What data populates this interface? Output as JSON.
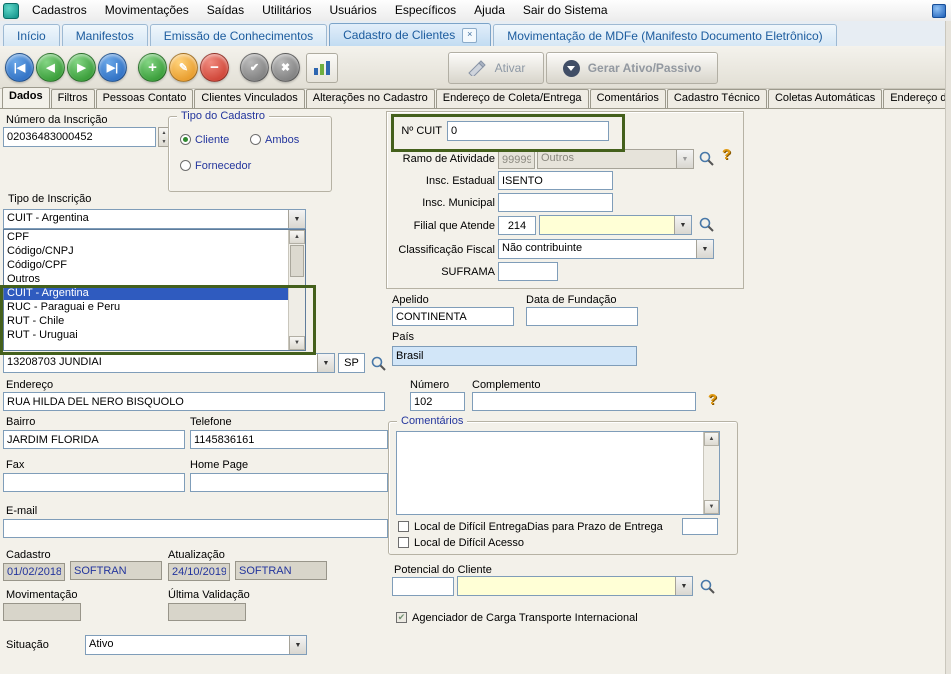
{
  "menu": {
    "items": [
      "Cadastros",
      "Movimentações",
      "Saídas",
      "Utilitários",
      "Usuários",
      "Específicos",
      "Ajuda",
      "Sair do Sistema"
    ]
  },
  "doc_tabs": {
    "items": [
      "Início",
      "Manifestos",
      "Emissão de Conhecimentos",
      "Cadastro de Clientes",
      "Movimentação de MDFe (Manifesto Documento Eletrônico)"
    ],
    "active": "Cadastro de Clientes"
  },
  "toolbar": {
    "ativar_label": "Ativar",
    "gerar_label": "Gerar Ativo/Passivo",
    "icons": {
      "first": "|◀",
      "prev": "◀",
      "next": "▶",
      "last": "▶|",
      "add": "+",
      "edit": "✎",
      "delete": "−",
      "confirm": "✔",
      "cancel": "✖"
    }
  },
  "form_tabs": {
    "items": [
      "Dados",
      "Filtros",
      "Pessoas Contato",
      "Clientes Vinculados",
      "Alterações no Cadastro",
      "Endereço de Coleta/Entrega",
      "Comentários",
      "Cadastro Técnico",
      "Coletas Automáticas",
      "Endereço de C"
    ],
    "active": "Dados"
  },
  "icons": {
    "help": "?"
  },
  "colors": {
    "highlight_green": "#44601c",
    "accent_blue": "#2f5bbf",
    "field_yellow": "#ffffd6"
  },
  "fields": {
    "numero_inscricao": {
      "label": "Número da Inscrição",
      "value": "02036483000452"
    },
    "tipo_cadastro": {
      "legend": "Tipo do Cadastro",
      "cliente": "Cliente",
      "ambos": "Ambos",
      "fornecedor": "Fornecedor",
      "selected": "Cliente"
    },
    "tipo_inscricao": {
      "label": "Tipo de Inscrição",
      "value": "CUIT - Argentina",
      "selected": "CUIT - Argentina",
      "options": [
        "CPF",
        "Código/CNPJ",
        "Código/CPF",
        "Outros",
        "CUIT - Argentina",
        "RUC - Paraguai e Peru",
        "RUT - Chile",
        "RUT - Uruguai"
      ]
    },
    "cuit": {
      "label": "Nº CUIT",
      "value": "0"
    },
    "ramo_atividade": {
      "label": "Ramo de Atividade",
      "code": "99999",
      "desc": "Outros"
    },
    "insc_estadual": {
      "label": "Insc. Estadual",
      "value": "ISENTO"
    },
    "insc_municipal": {
      "label": "Insc. Municipal",
      "value": ""
    },
    "filial_atende": {
      "label": "Filial que Atende",
      "value": "214",
      "desc": ""
    },
    "classificacao_fiscal": {
      "label": "Classificação Fiscal",
      "value": "Não contribuinte"
    },
    "suframa": {
      "label": "SUFRAMA",
      "value": ""
    },
    "apelido": {
      "label": "Apelido",
      "value": "CONTINENTA"
    },
    "data_fundacao": {
      "label": "Data de Fundação",
      "value": ""
    },
    "pais": {
      "label": "País",
      "value": "Brasil"
    },
    "cep": {
      "value": "13208703 JUNDIAI",
      "uf": "SP"
    },
    "endereco": {
      "label": "Endereço",
      "value": "RUA HILDA DEL NERO BISQUOLO"
    },
    "numero": {
      "label": "Número",
      "value": "102"
    },
    "complemento": {
      "label": "Complemento",
      "value": ""
    },
    "bairro": {
      "label": "Bairro",
      "value": "JARDIM FLORIDA"
    },
    "telefone": {
      "label": "Telefone",
      "value": "1145836161"
    },
    "fax": {
      "label": "Fax",
      "value": ""
    },
    "home_page": {
      "label": "Home Page",
      "value": ""
    },
    "email": {
      "label": "E-mail",
      "value": ""
    },
    "cadastro": {
      "label": "Cadastro",
      "date": "01/02/2018",
      "user": "SOFTRAN"
    },
    "atualizacao": {
      "label": "Atualização",
      "date": "24/10/2019",
      "user": "SOFTRAN"
    },
    "movimentacao": {
      "label": "Movimentação",
      "value": ""
    },
    "ultima_validacao": {
      "label": "Última Validação",
      "value": ""
    },
    "situacao": {
      "label": "Situação",
      "value": "Ativo"
    },
    "comentarios": {
      "legend": "Comentários",
      "value": "",
      "dificil_entrega": "Local de Difícil Entrega",
      "dificil_acesso": "Local de Difícil Acesso",
      "dias_prazo_label": "Dias para Prazo de Entrega",
      "dias_prazo_value": ""
    },
    "potencial_cliente": {
      "label": "Potencial do Cliente",
      "value": "",
      "desc": ""
    },
    "agenciador": {
      "label": "Agenciador de Carga Transporte Internacional",
      "checked": true
    }
  }
}
